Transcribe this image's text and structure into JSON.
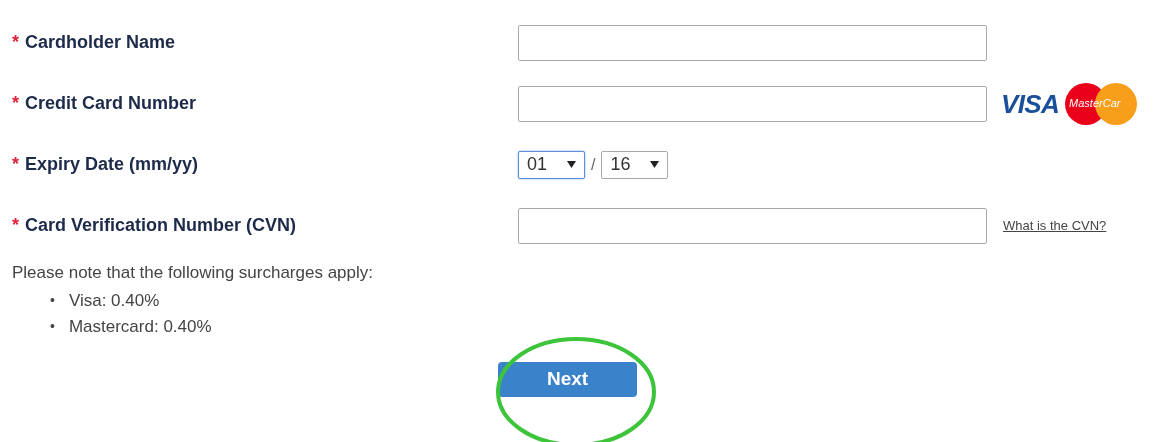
{
  "fields": [
    {
      "kind": "text",
      "label": "Cardholder Name",
      "required": true
    },
    {
      "kind": "text",
      "label": "Credit Card Number",
      "required": true,
      "logos": [
        {
          "kind": "visa",
          "text": "VISA"
        },
        {
          "kind": "mastercard",
          "text": "MasterCar"
        }
      ]
    },
    {
      "kind": "date",
      "label": "Expiry Date (mm/yy)",
      "required": true,
      "separator": "/",
      "selects": [
        {
          "value": "01",
          "focused": true
        },
        {
          "value": "16",
          "focused": false
        }
      ]
    },
    {
      "kind": "text",
      "label": "Card Verification Number (CVN)",
      "required": true,
      "link": "What is the CVN?"
    }
  ],
  "required_mark": "*",
  "note": "Please note that the following surcharges apply:",
  "surcharges": [
    {
      "bullet": "•",
      "text": "Visa: 0.40%"
    },
    {
      "bullet": "•",
      "text": "Mastercard: 0.40%"
    }
  ],
  "next_button": {
    "label": "Next",
    "highlighted": true
  }
}
